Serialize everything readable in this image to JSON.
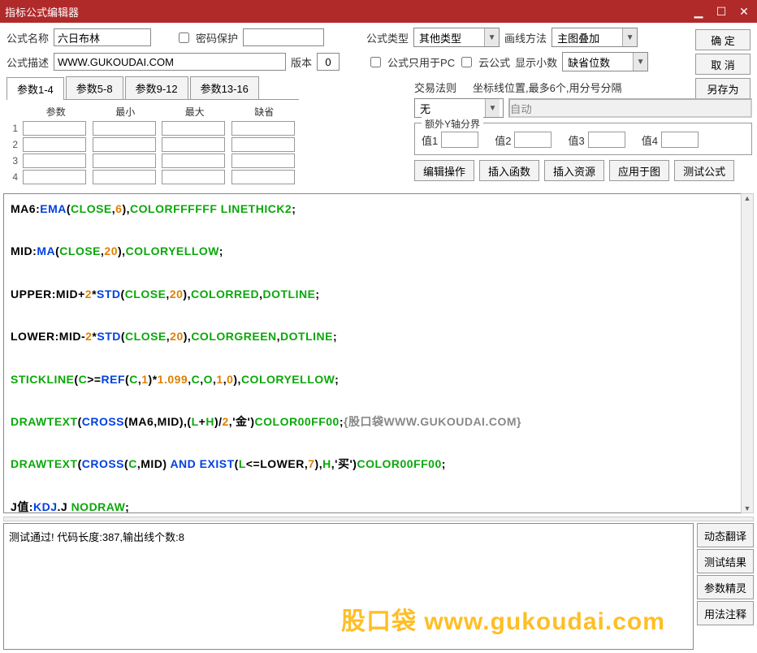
{
  "window": {
    "title": "指标公式编辑器"
  },
  "labels": {
    "formula_name": "公式名称",
    "password_protect": "密码保护",
    "formula_type": "公式类型",
    "draw_method": "画线方法",
    "formula_desc": "公式描述",
    "version": "版本",
    "pc_only": "公式只用于PC",
    "cloud": "云公式",
    "show_decimal": "显示小数",
    "trade_rule": "交易法则",
    "coord_hint": "坐标线位置,最多6个,用分号分隔",
    "extra_y": "额外Y轴分界",
    "v1": "值1",
    "v2": "值2",
    "v3": "值3",
    "v4": "值4",
    "param": "参数",
    "min": "最小",
    "max": "最大",
    "default": "缺省"
  },
  "values": {
    "formula_name": "六日布林",
    "formula_desc": "WWW.GUKOUDAI.COM",
    "version": "0",
    "formula_type": "其他类型",
    "draw_method": "主图叠加",
    "show_decimal": "缺省位数",
    "trade_rule": "无",
    "coord_auto": "自动"
  },
  "tabs": [
    "参数1-4",
    "参数5-8",
    "参数9-12",
    "参数13-16"
  ],
  "param_rows": [
    "1",
    "2",
    "3",
    "4"
  ],
  "buttons": {
    "ok": "确 定",
    "cancel": "取 消",
    "saveas": "另存为",
    "edit_op": "编辑操作",
    "insert_fn": "插入函数",
    "insert_res": "插入资源",
    "apply_chart": "应用于图",
    "test_formula": "测试公式",
    "dyn_trans": "动态翻译",
    "test_result": "测试结果",
    "param_wizard": "参数精灵",
    "usage_note": "用法注释"
  },
  "output": "测试通过! 代码长度:387,输出线个数:8",
  "watermark": "股口袋  www.gukoudai.com",
  "code": [
    {
      "t": "MA6",
      "c": "black"
    },
    {
      "t": ":",
      "c": "black"
    },
    {
      "t": "EMA",
      "c": "blue"
    },
    {
      "t": "(",
      "c": "black"
    },
    {
      "t": "CLOSE",
      "c": "green"
    },
    {
      "t": ",",
      "c": "black"
    },
    {
      "t": "6",
      "c": "orange"
    },
    {
      "t": ")",
      "c": "black"
    },
    {
      "t": ",",
      "c": "black"
    },
    {
      "t": "COLORFFFFFF LINETHICK2",
      "c": "green"
    },
    {
      "t": ";",
      "c": "black"
    },
    {
      "t": "\n\n",
      "c": "black"
    },
    {
      "t": "MID",
      "c": "black"
    },
    {
      "t": ":",
      "c": "black"
    },
    {
      "t": "MA",
      "c": "blue"
    },
    {
      "t": "(",
      "c": "black"
    },
    {
      "t": "CLOSE",
      "c": "green"
    },
    {
      "t": ",",
      "c": "black"
    },
    {
      "t": "20",
      "c": "orange"
    },
    {
      "t": ")",
      "c": "black"
    },
    {
      "t": ",",
      "c": "black"
    },
    {
      "t": "COLORYELLOW",
      "c": "green"
    },
    {
      "t": ";",
      "c": "black"
    },
    {
      "t": "\n\n",
      "c": "black"
    },
    {
      "t": "UPPER",
      "c": "black"
    },
    {
      "t": ":",
      "c": "black"
    },
    {
      "t": "MID",
      "c": "black"
    },
    {
      "t": "+",
      "c": "black"
    },
    {
      "t": "2",
      "c": "orange"
    },
    {
      "t": "*",
      "c": "black"
    },
    {
      "t": "STD",
      "c": "blue"
    },
    {
      "t": "(",
      "c": "black"
    },
    {
      "t": "CLOSE",
      "c": "green"
    },
    {
      "t": ",",
      "c": "black"
    },
    {
      "t": "20",
      "c": "orange"
    },
    {
      "t": ")",
      "c": "black"
    },
    {
      "t": ",",
      "c": "black"
    },
    {
      "t": "COLORRED",
      "c": "green"
    },
    {
      "t": ",",
      "c": "black"
    },
    {
      "t": "DOTLINE",
      "c": "green"
    },
    {
      "t": ";",
      "c": "black"
    },
    {
      "t": "\n\n",
      "c": "black"
    },
    {
      "t": "LOWER",
      "c": "black"
    },
    {
      "t": ":",
      "c": "black"
    },
    {
      "t": "MID",
      "c": "black"
    },
    {
      "t": "-",
      "c": "black"
    },
    {
      "t": "2",
      "c": "orange"
    },
    {
      "t": "*",
      "c": "black"
    },
    {
      "t": "STD",
      "c": "blue"
    },
    {
      "t": "(",
      "c": "black"
    },
    {
      "t": "CLOSE",
      "c": "green"
    },
    {
      "t": ",",
      "c": "black"
    },
    {
      "t": "20",
      "c": "orange"
    },
    {
      "t": ")",
      "c": "black"
    },
    {
      "t": ",",
      "c": "black"
    },
    {
      "t": "COLORGREEN",
      "c": "green"
    },
    {
      "t": ",",
      "c": "black"
    },
    {
      "t": "DOTLINE",
      "c": "green"
    },
    {
      "t": ";",
      "c": "black"
    },
    {
      "t": "\n\n",
      "c": "black"
    },
    {
      "t": "STICKLINE",
      "c": "green"
    },
    {
      "t": "(",
      "c": "black"
    },
    {
      "t": "C",
      "c": "green"
    },
    {
      "t": ">=",
      "c": "black"
    },
    {
      "t": "REF",
      "c": "blue"
    },
    {
      "t": "(",
      "c": "black"
    },
    {
      "t": "C",
      "c": "green"
    },
    {
      "t": ",",
      "c": "black"
    },
    {
      "t": "1",
      "c": "orange"
    },
    {
      "t": ")",
      "c": "black"
    },
    {
      "t": "*",
      "c": "black"
    },
    {
      "t": "1.099",
      "c": "orange"
    },
    {
      "t": ",",
      "c": "black"
    },
    {
      "t": "C",
      "c": "green"
    },
    {
      "t": ",",
      "c": "black"
    },
    {
      "t": "O",
      "c": "green"
    },
    {
      "t": ",",
      "c": "black"
    },
    {
      "t": "1",
      "c": "orange"
    },
    {
      "t": ",",
      "c": "black"
    },
    {
      "t": "0",
      "c": "orange"
    },
    {
      "t": ")",
      "c": "black"
    },
    {
      "t": ",",
      "c": "black"
    },
    {
      "t": "COLORYELLOW",
      "c": "green"
    },
    {
      "t": ";",
      "c": "black"
    },
    {
      "t": "\n\n",
      "c": "black"
    },
    {
      "t": "DRAWTEXT",
      "c": "green"
    },
    {
      "t": "(",
      "c": "black"
    },
    {
      "t": "CROSS",
      "c": "blue"
    },
    {
      "t": "(",
      "c": "black"
    },
    {
      "t": "MA6",
      "c": "black"
    },
    {
      "t": ",",
      "c": "black"
    },
    {
      "t": "MID",
      "c": "black"
    },
    {
      "t": ")",
      "c": "black"
    },
    {
      "t": ",",
      "c": "black"
    },
    {
      "t": "(",
      "c": "black"
    },
    {
      "t": "L",
      "c": "green"
    },
    {
      "t": "+",
      "c": "black"
    },
    {
      "t": "H",
      "c": "green"
    },
    {
      "t": ")",
      "c": "black"
    },
    {
      "t": "/",
      "c": "black"
    },
    {
      "t": "2",
      "c": "orange"
    },
    {
      "t": ",",
      "c": "black"
    },
    {
      "t": "'金'",
      "c": "black"
    },
    {
      "t": ")",
      "c": "black"
    },
    {
      "t": "COLOR00FF00",
      "c": "green"
    },
    {
      "t": ";",
      "c": "black"
    },
    {
      "t": "{股口袋WWW.GUKOUDAI.COM}",
      "c": "gray"
    },
    {
      "t": "\n\n",
      "c": "black"
    },
    {
      "t": "DRAWTEXT",
      "c": "green"
    },
    {
      "t": "(",
      "c": "black"
    },
    {
      "t": "CROSS",
      "c": "blue"
    },
    {
      "t": "(",
      "c": "black"
    },
    {
      "t": "C",
      "c": "green"
    },
    {
      "t": ",",
      "c": "black"
    },
    {
      "t": "MID",
      "c": "black"
    },
    {
      "t": ") ",
      "c": "black"
    },
    {
      "t": "AND",
      "c": "blue"
    },
    {
      "t": " ",
      "c": "black"
    },
    {
      "t": "EXIST",
      "c": "blue"
    },
    {
      "t": "(",
      "c": "black"
    },
    {
      "t": "L",
      "c": "green"
    },
    {
      "t": "<=",
      "c": "black"
    },
    {
      "t": "LOWER",
      "c": "black"
    },
    {
      "t": ",",
      "c": "black"
    },
    {
      "t": "7",
      "c": "orange"
    },
    {
      "t": ")",
      "c": "black"
    },
    {
      "t": ",",
      "c": "black"
    },
    {
      "t": "H",
      "c": "green"
    },
    {
      "t": ",",
      "c": "black"
    },
    {
      "t": "'买'",
      "c": "black"
    },
    {
      "t": ")",
      "c": "black"
    },
    {
      "t": "COLOR00FF00",
      "c": "green"
    },
    {
      "t": ";",
      "c": "black"
    },
    {
      "t": "\n\n",
      "c": "black"
    },
    {
      "t": "J值",
      "c": "black"
    },
    {
      "t": ":",
      "c": "black"
    },
    {
      "t": "KDJ",
      "c": "blue"
    },
    {
      "t": ".",
      "c": "black"
    },
    {
      "t": "J",
      "c": "black"
    },
    {
      "t": " ",
      "c": "black"
    },
    {
      "t": "NODRAW",
      "c": "green"
    },
    {
      "t": ";",
      "c": "black"
    }
  ]
}
